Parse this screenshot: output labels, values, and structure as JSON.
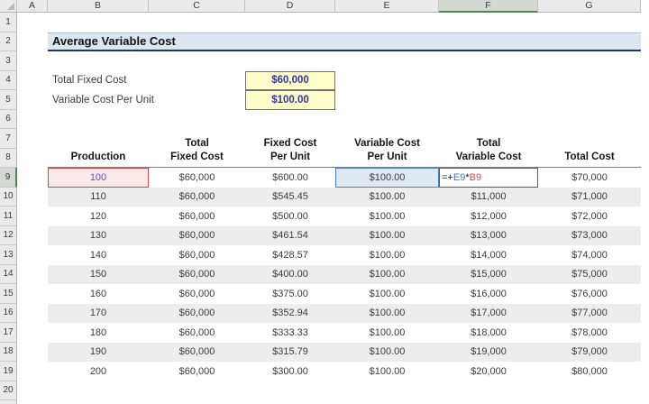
{
  "sheet": {
    "app": "Excel worksheet",
    "column_headers": [
      "A",
      "B",
      "C",
      "D",
      "E",
      "F",
      "G"
    ],
    "selected_column": "F",
    "row_numbers": [
      "1",
      "2",
      "3",
      "4",
      "5",
      "6",
      "7",
      "8",
      "9",
      "10",
      "11",
      "12",
      "13",
      "14",
      "15",
      "16",
      "17",
      "18",
      "19",
      "20"
    ],
    "selected_row": "9",
    "banner_title": "Average Variable Cost",
    "inputs": {
      "fixed_cost_label": "Total Fixed Cost",
      "fixed_cost_value": "$60,000",
      "variable_cost_label": "Variable Cost Per Unit",
      "variable_cost_value": "$100.00"
    },
    "table": {
      "headers": [
        {
          "line1": "",
          "line2": "Production"
        },
        {
          "line1": "Total",
          "line2": "Fixed Cost"
        },
        {
          "line1": "Fixed Cost",
          "line2": "Per Unit"
        },
        {
          "line1": "Variable Cost",
          "line2": "Per Unit"
        },
        {
          "line1": "Total",
          "line2": "Variable Cost"
        },
        {
          "line1": "",
          "line2": "Total Cost"
        }
      ],
      "active_row": {
        "production": "100",
        "total_fixed_cost": "$60,000",
        "fixed_cost_per_unit": "$600.00",
        "variable_cost_per_unit": "$100.00",
        "formula_prefix": "=+",
        "formula_ref1": "E9",
        "formula_op": "*",
        "formula_ref2": "B9",
        "total_cost": "$70,000"
      },
      "rows": [
        [
          "110",
          "$60,000",
          "$545.45",
          "$100.00",
          "$11,000",
          "$71,000"
        ],
        [
          "120",
          "$60,000",
          "$500.00",
          "$100.00",
          "$12,000",
          "$72,000"
        ],
        [
          "130",
          "$60,000",
          "$461.54",
          "$100.00",
          "$13,000",
          "$73,000"
        ],
        [
          "140",
          "$60,000",
          "$428.57",
          "$100.00",
          "$14,000",
          "$74,000"
        ],
        [
          "150",
          "$60,000",
          "$400.00",
          "$100.00",
          "$15,000",
          "$75,000"
        ],
        [
          "160",
          "$60,000",
          "$375.00",
          "$100.00",
          "$16,000",
          "$76,000"
        ],
        [
          "170",
          "$60,000",
          "$352.94",
          "$100.00",
          "$17,000",
          "$77,000"
        ],
        [
          "180",
          "$60,000",
          "$333.33",
          "$100.00",
          "$18,000",
          "$78,000"
        ],
        [
          "190",
          "$60,000",
          "$315.79",
          "$100.00",
          "$19,000",
          "$79,000"
        ],
        [
          "200",
          "$60,000",
          "$300.00",
          "$100.00",
          "$20,000",
          "$80,000"
        ]
      ],
      "banded_sheet_rows": [
        10,
        12,
        14,
        16,
        18
      ]
    },
    "colors": {
      "banner_fill": "#dce6f1",
      "banner_border": "#1f3864",
      "input_fill": "#ffffcc",
      "input_text": "#34349b",
      "ref1_fill": "#dfe9f3",
      "ref1_border": "#4f81bd",
      "ref2_fill": "#fbe9ea",
      "ref2_border": "#c0504d",
      "formula_ref1_text": "#4472c4",
      "formula_ref2_text": "#c0504d",
      "band_fill": "#ededed",
      "selected_header_fill": "#d3d8d3",
      "selected_header_accent": "#4e8a4e"
    }
  }
}
